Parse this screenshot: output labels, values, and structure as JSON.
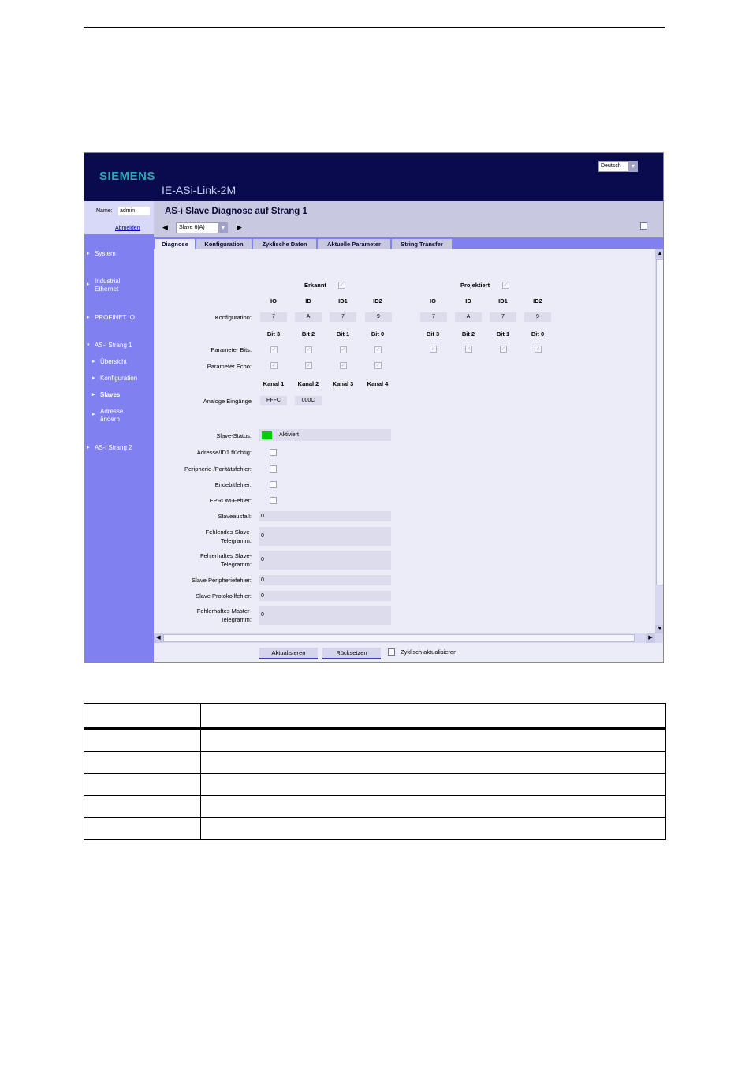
{
  "header": {
    "brand": "SIEMENS",
    "product": "IE-ASi-Link-2M",
    "language": "Deutsch"
  },
  "sidebar": {
    "name_label": "Name:",
    "name_value": "admin",
    "logout": "Abmelden",
    "items": [
      {
        "label": "System"
      },
      {
        "label": "Industrial Ethernet"
      },
      {
        "label": "PROFINET IO"
      },
      {
        "label": "AS-i Strang 1"
      },
      {
        "label": "Übersicht"
      },
      {
        "label": "Konfiguration"
      },
      {
        "label": "Slaves"
      },
      {
        "label": "Adresse ändern"
      },
      {
        "label": "AS-i Strang 2"
      }
    ]
  },
  "page": {
    "title": "AS-i Slave Diagnose auf Strang 1",
    "slave_select": "Slave 6(A)"
  },
  "tabs": [
    "Diagnose",
    "Konfiguration",
    "Zyklische Daten",
    "Aktuelle Parameter",
    "String Transfer"
  ],
  "diag": {
    "erkannt_label": "Erkannt",
    "projektiert_label": "Projektiert",
    "cols": [
      "IO",
      "ID",
      "ID1",
      "ID2"
    ],
    "konfig_label": "Konfiguration:",
    "erkannt_values": [
      "7",
      "A",
      "7",
      "9"
    ],
    "projektiert_values": [
      "7",
      "A",
      "7",
      "9"
    ],
    "bits": [
      "Bit 3",
      "Bit 2",
      "Bit 1",
      "Bit 0"
    ],
    "param_bits_label": "Parameter Bits:",
    "param_echo_label": "Parameter Echo:",
    "kanaele": [
      "Kanal 1",
      "Kanal 2",
      "Kanal 3",
      "Kanal 4"
    ],
    "analog_label": "Analoge Eingänge",
    "analog_values": [
      "FFFC",
      "000C"
    ],
    "status_label": "Slave-Status:",
    "status_value": "Aktiviert",
    "flag_labels": [
      "Adresse/ID1 flüchtig:",
      "Peripherie-/Paritätsfehler:",
      "Endebitfehler:",
      "EPROM-Fehler:"
    ],
    "counters": [
      {
        "label": "Slaveausfall:",
        "value": "0"
      },
      {
        "label": "Fehlendes Slave-Telegramm:",
        "value": "0"
      },
      {
        "label": "Fehlerhaftes Slave-Telegramm:",
        "value": "0"
      },
      {
        "label": "Slave Peripheriefehler:",
        "value": "0"
      },
      {
        "label": "Slave Protokollfehler:",
        "value": "0"
      },
      {
        "label": "Fehlerhaftes Master-Telegramm:",
        "value": "0"
      }
    ]
  },
  "buttons": {
    "refresh": "Aktualisieren",
    "reset": "Rücksetzen",
    "cyclic": "Zyklisch aktualisieren"
  },
  "colors": {
    "header_bg": "#0a0a4e",
    "sidebar_bg": "#8080f0",
    "brand": "#28a8b0",
    "status_ok": "#00cc00"
  }
}
